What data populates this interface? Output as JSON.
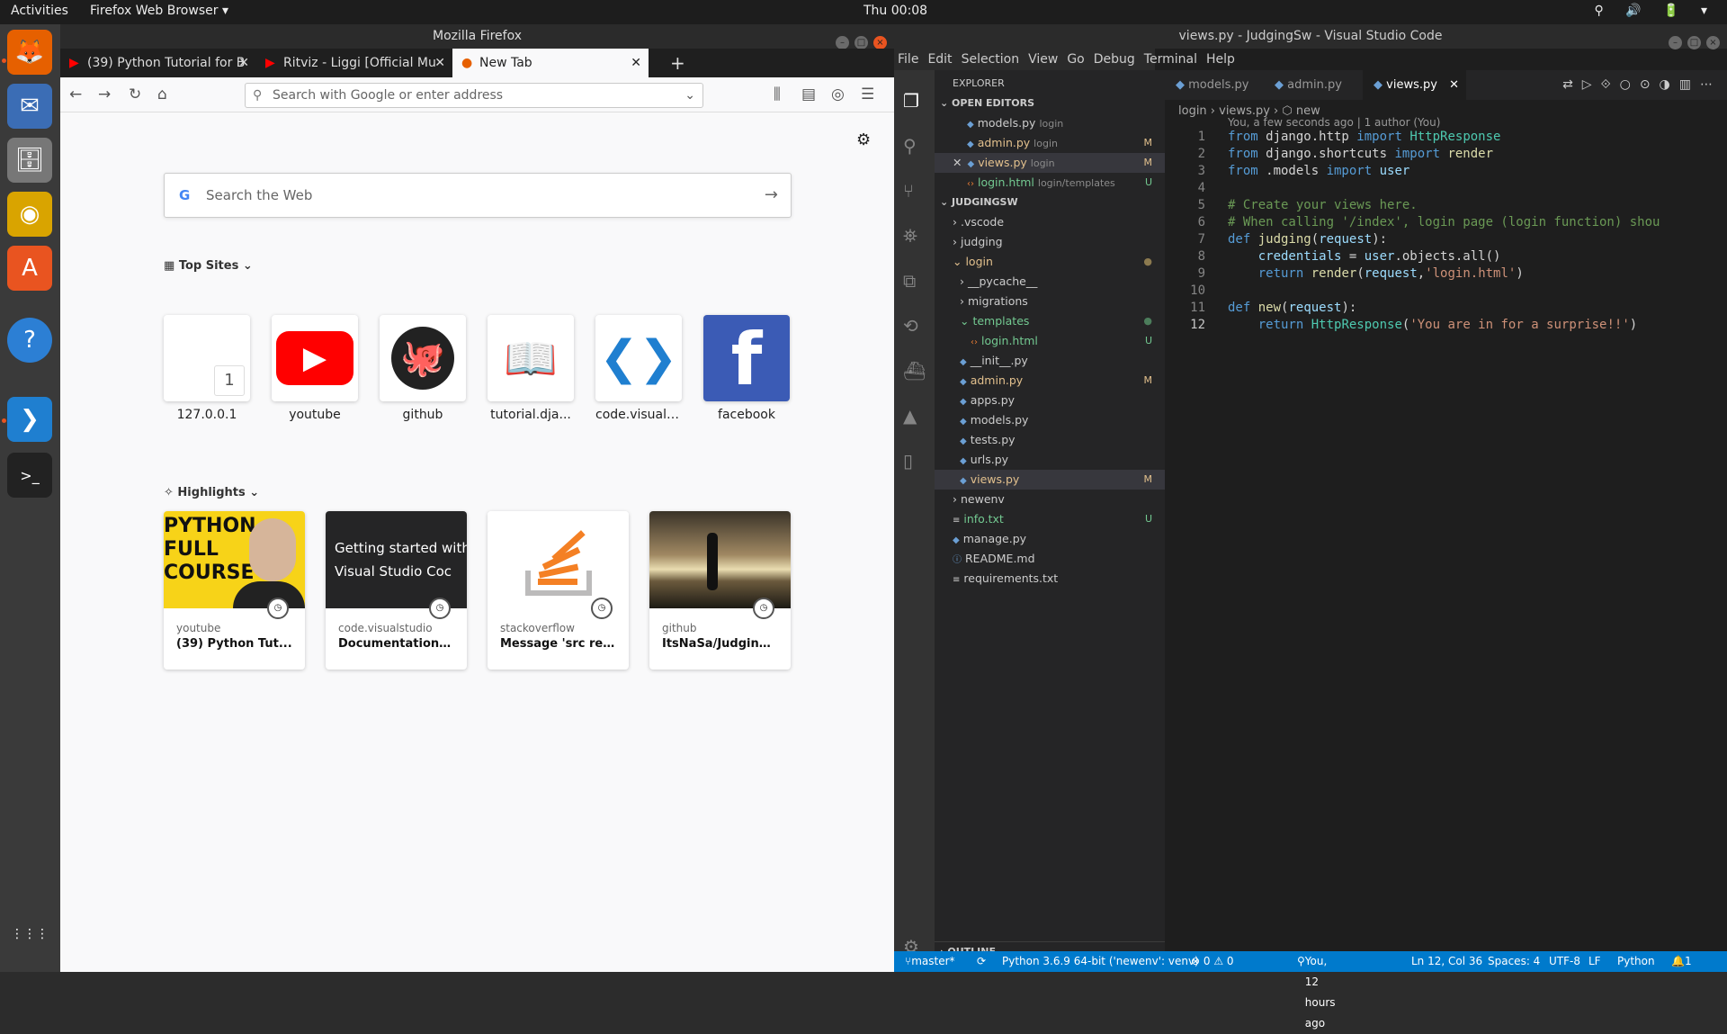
{
  "topbar": {
    "activities": "Activities",
    "app": "Firefox Web Browser ▾",
    "clock": "Thu 00:08",
    "tray": "⚲ 🔊 🔋 ▾"
  },
  "dock": [
    {
      "name": "firefox",
      "glyph": "🦊"
    },
    {
      "name": "thunderbird",
      "glyph": "✉"
    },
    {
      "name": "files",
      "glyph": "🗄"
    },
    {
      "name": "rhythmbox",
      "glyph": "◉"
    },
    {
      "name": "software",
      "glyph": "A"
    },
    {
      "name": "help",
      "glyph": "?"
    },
    {
      "name": "vscode",
      "glyph": "❯"
    },
    {
      "name": "terminal",
      "glyph": ">_"
    },
    {
      "name": "apps-grid",
      "glyph": "⋮⋮⋮"
    }
  ],
  "firefox": {
    "window_title": "Mozilla Firefox",
    "tabs": [
      {
        "label": "(39) Python Tutorial for B"
      },
      {
        "label": "Ritviz - Liggi [Official Mu"
      },
      {
        "label": "New Tab"
      }
    ],
    "url_placeholder": "Search with Google or enter address",
    "search_placeholder": "Search the Web",
    "top_sites_heading": "Top Sites",
    "top_sites": [
      {
        "label": "127.0.0.1",
        "glyph": "1"
      },
      {
        "label": "youtube",
        "glyph": "▶"
      },
      {
        "label": "github",
        "glyph": "🐙"
      },
      {
        "label": "tutorial.dja...",
        "glyph": "📖"
      },
      {
        "label": "code.visuals...",
        "glyph": "❮❯"
      },
      {
        "label": "facebook",
        "glyph": "f"
      }
    ],
    "highlights_heading": "Highlights",
    "highlights": [
      {
        "source": "youtube",
        "title": "(39) Python Tut...",
        "image_text": "PYTHON\nFULL\nCOURSE"
      },
      {
        "source": "code.visualstudio",
        "title": "Documentation ...",
        "image_text": "Getting started with\nVisual Studio Coc"
      },
      {
        "source": "stackoverflow",
        "title": "Message 'src ref...",
        "image_text": ""
      },
      {
        "source": "github",
        "title": "ItsNaSa/Judging...",
        "image_text": ""
      }
    ]
  },
  "vscode": {
    "window_title": "views.py - JudgingSw - Visual Studio Code",
    "menu": [
      "File",
      "Edit",
      "Selection",
      "View",
      "Go",
      "Debug",
      "Terminal",
      "Help"
    ],
    "explorer_title": "EXPLORER",
    "open_editors_heading": "OPEN EDITORS",
    "open_editors": [
      {
        "name": "models.py",
        "dir": "login",
        "badge": ""
      },
      {
        "name": "admin.py",
        "dir": "login",
        "badge": "M"
      },
      {
        "name": "views.py",
        "dir": "login",
        "badge": "M"
      },
      {
        "name": "login.html",
        "dir": "login/templates",
        "badge": "U"
      }
    ],
    "project_heading": "JUDGINGSW",
    "tree": [
      {
        "name": ".vscode",
        "badge": ""
      },
      {
        "name": "judging",
        "badge": ""
      },
      {
        "name": "login",
        "badge": "●"
      },
      {
        "name": "__pycache__",
        "badge": ""
      },
      {
        "name": "migrations",
        "badge": ""
      },
      {
        "name": "templates",
        "badge": "●"
      },
      {
        "name": "login.html",
        "badge": "U"
      },
      {
        "name": "__init__.py",
        "badge": ""
      },
      {
        "name": "admin.py",
        "badge": "M"
      },
      {
        "name": "apps.py",
        "badge": ""
      },
      {
        "name": "models.py",
        "badge": ""
      },
      {
        "name": "tests.py",
        "badge": ""
      },
      {
        "name": "urls.py",
        "badge": ""
      },
      {
        "name": "views.py",
        "badge": "M"
      },
      {
        "name": "newenv",
        "badge": ""
      },
      {
        "name": "info.txt",
        "badge": "U"
      },
      {
        "name": "manage.py",
        "badge": ""
      },
      {
        "name": "README.md",
        "badge": ""
      },
      {
        "name": "requirements.txt",
        "badge": ""
      }
    ],
    "outline_heading": "OUTLINE",
    "editor_tabs": [
      "models.py",
      "admin.py",
      "views.py"
    ],
    "breadcrumb": "login  ›  views.py  ›  ⬡ new",
    "blame": "You, a few seconds ago | 1 author (You)",
    "line_numbers": [
      "1",
      "2",
      "3",
      "4",
      "5",
      "6",
      "7",
      "8",
      "9",
      "10",
      "11",
      "12"
    ],
    "status": {
      "branch": "master*",
      "python": "Python 3.6.9 64-bit ('newenv': venv)",
      "problems": "⊗ 0 ⚠ 0",
      "blame": "You, 12 hours ago",
      "position": "Ln 12, Col 36",
      "spaces": "Spaces: 4",
      "encoding": "UTF-8",
      "eol": "LF",
      "language": "Python",
      "bell": "🔔1"
    }
  }
}
